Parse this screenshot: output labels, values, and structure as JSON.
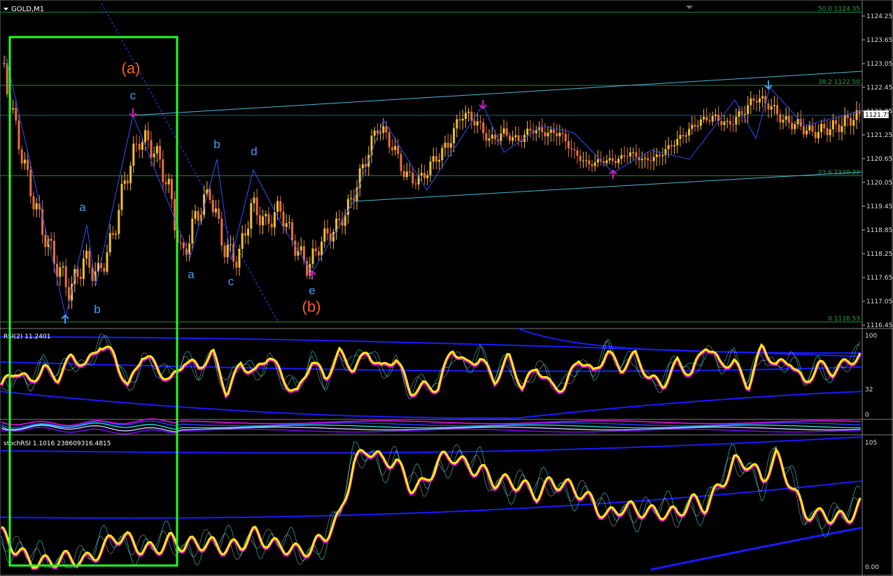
{
  "window": {
    "symbol_title": "GOLD,M1"
  },
  "colors": {
    "background": "#000000",
    "candle_up": "#f0c030",
    "candle_down": "#e87040",
    "wave_line": "#3050ff",
    "channel": "#4fb6d8",
    "fib": "#1f8a3a",
    "fib_text": "#29a04a",
    "box": "#20ff20",
    "wave_label": "#3aa0ff",
    "degree_label": "#ff5a1e",
    "arrow_up": "#3aa0ff",
    "arrow_magenta": "#d020c0",
    "rsi_main": "#ffee00",
    "rsi_shadow": "#ff00ff",
    "band": "#1a1aff",
    "cyan": "#20d0d0"
  },
  "main": {
    "price_scale": [
      "1124.25",
      "1123.65",
      "1123.05",
      "1122.45",
      "1121.85",
      "1121.25",
      "1120.65",
      "1120.05",
      "1119.45",
      "1118.85",
      "1118.25",
      "1117.65",
      "1117.05",
      "1116.45"
    ],
    "current_price": "1121.75",
    "fib_levels": [
      {
        "label": "50.0 1124.35",
        "price": 1124.35
      },
      {
        "label": "38.2 1122.50",
        "price": 1122.5
      },
      {
        "label": "23.6 1120.22",
        "price": 1120.22
      },
      {
        "label": "0 1116.53",
        "price": 1116.53
      }
    ],
    "wave_labels": {
      "degree_a": "(a)",
      "degree_b": "(b)",
      "a1": "a",
      "b1": "b",
      "c1": "c",
      "a2": "a",
      "b2": "b",
      "c2": "c",
      "d2": "d",
      "e2": "e"
    }
  },
  "rsi_panel": {
    "label": "RSI(2) 11.2401",
    "scale": [
      "100",
      "32",
      "0"
    ]
  },
  "stoch_panel": {
    "label": "stochRSI 1.1016 238609316.4815",
    "scale": [
      "105",
      "0.00"
    ]
  },
  "chart_data": [
    {
      "type": "line",
      "title": "GOLD,M1",
      "ylabel": "",
      "ylim": [
        1116.45,
        1124.45
      ],
      "x": [
        0,
        20,
        40,
        60,
        80,
        100,
        120,
        140,
        160,
        180,
        200,
        220,
        240,
        260,
        280,
        300,
        320,
        340,
        360,
        380,
        400,
        420,
        440,
        460,
        480,
        500,
        520,
        540,
        560,
        580,
        600,
        620,
        640,
        660,
        680,
        700,
        720,
        740,
        760,
        780,
        800,
        820,
        840,
        860,
        880,
        900,
        920,
        940,
        960,
        980,
        1000,
        1020,
        1040,
        1060,
        1080,
        1100,
        1120,
        1140,
        1160,
        1180,
        1200,
        1220
      ],
      "series": [
        {
          "name": "",
          "values": [
            1123.4,
            1121.6,
            1120.1,
            1118.9,
            1118.0,
            1117.3,
            1118.1,
            1117.7,
            1118.6,
            1120.2,
            1121.2,
            1120.9,
            1120.0,
            1118.1,
            1119.2,
            1119.8,
            1118.4,
            1118.1,
            1119.5,
            1119.0,
            1119.4,
            1118.5,
            1117.9,
            1118.6,
            1118.9,
            1119.5,
            1120.5,
            1121.5,
            1121.0,
            1120.2,
            1120.1,
            1120.6,
            1121.0,
            1121.8,
            1121.6,
            1121.1,
            1121.3,
            1121.1,
            1121.4,
            1121.3,
            1121.3,
            1120.8,
            1120.5,
            1120.6,
            1120.6,
            1120.8,
            1120.6,
            1120.7,
            1121.0,
            1121.3,
            1121.6,
            1121.7,
            1121.5,
            1121.8,
            1122.2,
            1122.0,
            1121.6,
            1121.5,
            1121.3,
            1121.4,
            1121.5,
            1121.7
          ]
        }
      ]
    },
    {
      "type": "line",
      "title": "RSI(2) 11.2401",
      "ylim": [
        0,
        100
      ],
      "series": [
        {
          "name": "",
          "values": [
            35,
            52,
            40,
            62,
            48,
            70,
            58,
            90,
            78,
            32,
            72,
            60,
            45,
            70,
            55,
            75,
            30,
            68,
            50,
            72,
            45,
            30,
            70,
            42,
            75,
            60,
            82,
            55,
            68,
            30,
            40,
            35,
            80,
            60,
            75,
            45,
            70,
            30,
            62,
            40,
            35,
            68,
            50,
            82,
            60,
            72,
            42,
            40,
            70,
            50,
            85,
            62,
            70,
            38,
            82,
            58,
            70,
            42,
            62,
            50,
            65,
            78
          ]
        }
      ]
    },
    {
      "type": "line",
      "title": "stochRSI 1.1016 238609316.4815",
      "ylim": [
        0,
        105
      ],
      "series": [
        {
          "name": "",
          "values": [
            25,
            15,
            10,
            6,
            4,
            5,
            8,
            18,
            25,
            20,
            15,
            20,
            25,
            15,
            18,
            22,
            20,
            18,
            25,
            20,
            22,
            15,
            12,
            25,
            45,
            90,
            98,
            85,
            90,
            72,
            70,
            85,
            92,
            88,
            85,
            70,
            68,
            70,
            65,
            72,
            65,
            62,
            58,
            45,
            48,
            45,
            48,
            50,
            45,
            52,
            50,
            72,
            90,
            85,
            70,
            95,
            75,
            45,
            40,
            42,
            45,
            55
          ]
        }
      ]
    }
  ]
}
